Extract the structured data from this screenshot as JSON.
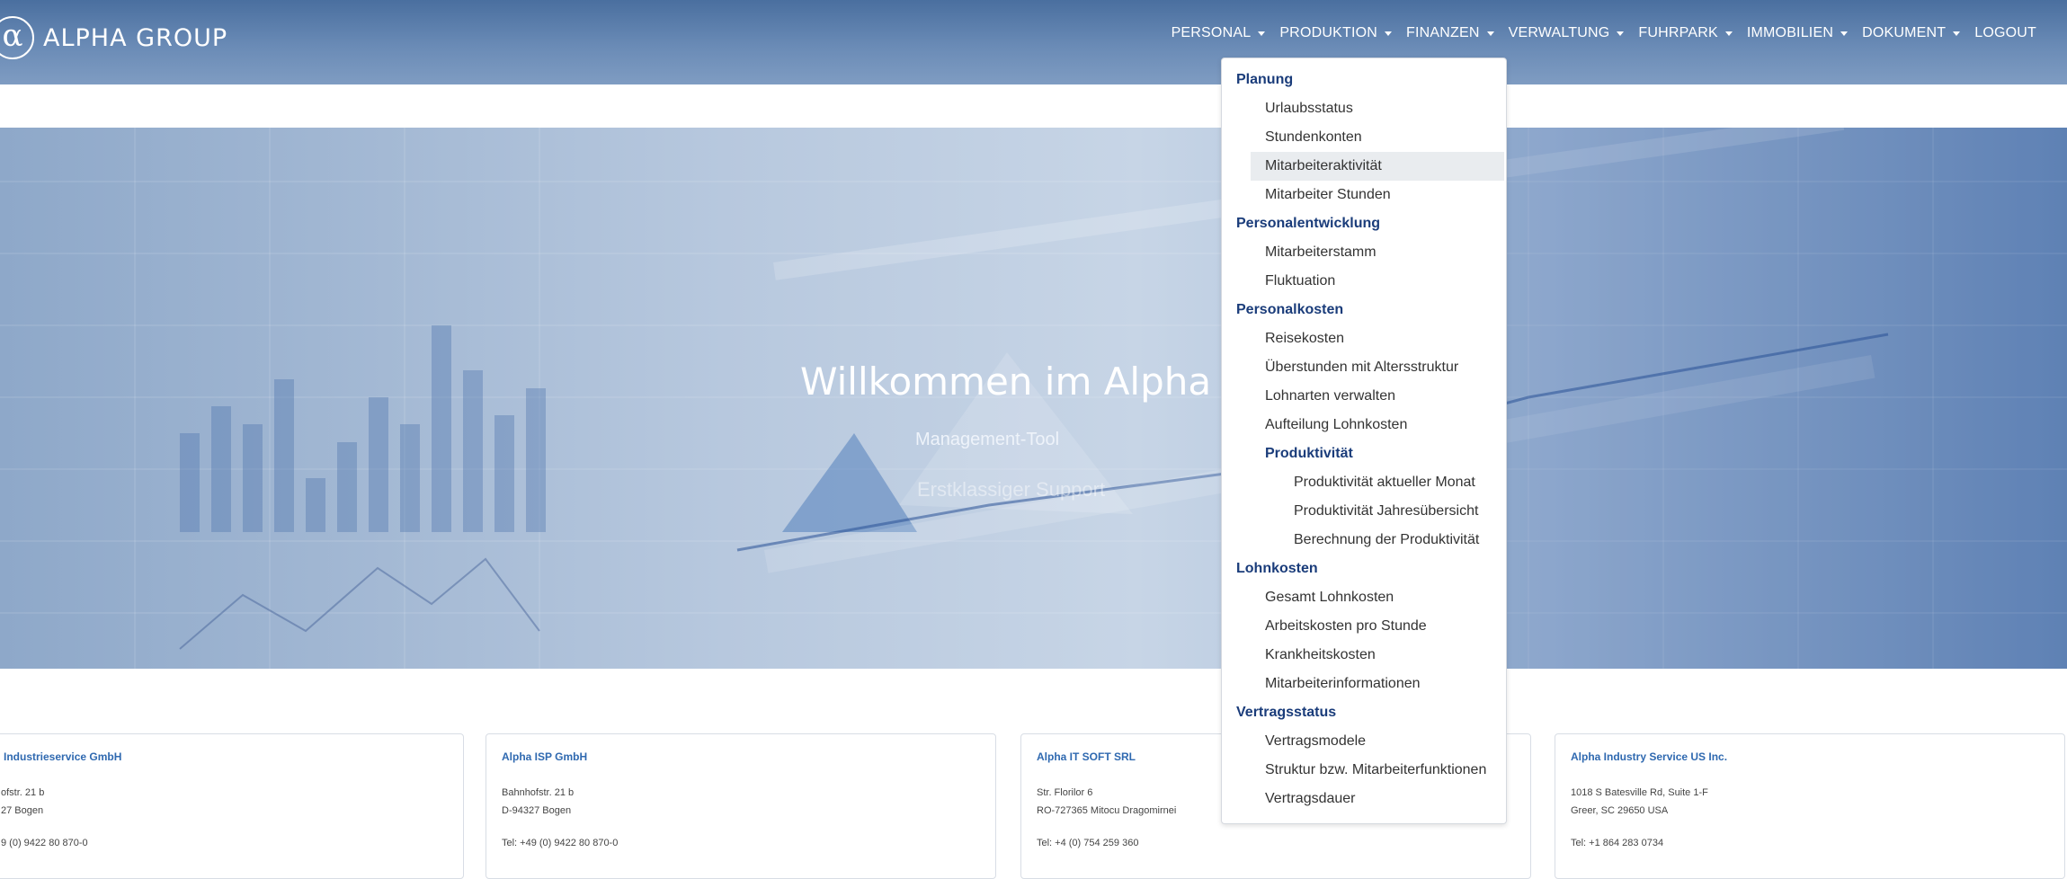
{
  "header": {
    "logo_glyph": "α",
    "logo_text": "ALPHA GROUP",
    "nav": [
      {
        "label": "PERSONAL",
        "has_caret": true
      },
      {
        "label": "PRODUKTION",
        "has_caret": true
      },
      {
        "label": "FINANZEN",
        "has_caret": true
      },
      {
        "label": "VERWALTUNG",
        "has_caret": true
      },
      {
        "label": "FUHRPARK",
        "has_caret": true
      },
      {
        "label": "IMMOBILIEN",
        "has_caret": true
      },
      {
        "label": "DOKUMENT",
        "has_caret": true
      },
      {
        "label": "LOGOUT",
        "has_caret": false
      }
    ]
  },
  "hero": {
    "title": "Willkommen im Alpha Gro",
    "subtitle": "Management-Tool",
    "subtitle2": "Erstklassiger Support"
  },
  "dropdown": {
    "sections": [
      {
        "heading": "Planung",
        "items": [
          "Urlaubsstatus",
          "Stundenkonten",
          "Mitarbeiteraktivität",
          "Mitarbeiter Stunden"
        ]
      },
      {
        "heading": "Personalentwicklung",
        "items": [
          "Mitarbeiterstamm",
          "Fluktuation"
        ]
      },
      {
        "heading": "Personalkosten",
        "items": [
          "Reisekosten",
          "Überstunden mit Altersstruktur",
          "Lohnarten verwalten",
          "Aufteilung Lohnkosten"
        ],
        "subheading": "Produktivität",
        "subitems": [
          "Produktivität aktueller Monat",
          "Produktivität Jahresübersicht",
          "Berechnung der Produktivität"
        ]
      },
      {
        "heading": "Lohnkosten",
        "items": [
          "Gesamt Lohnkosten",
          "Arbeitskosten pro Stunde",
          "Krankheitskosten",
          "Mitarbeiterinformationen"
        ]
      },
      {
        "heading": "Vertragsstatus",
        "items": [
          "Vertragsmodele",
          "Struktur bzw. Mitarbeiterfunktionen",
          "Vertragsdauer"
        ]
      }
    ],
    "active_item": "Mitarbeiteraktivität"
  },
  "cards": [
    {
      "name": "Industrieservice GmbH",
      "address1": "ofstr. 21 b",
      "address2": "27 Bogen",
      "phone": "9 (0) 9422 80 870-0"
    },
    {
      "name": "Alpha ISP GmbH",
      "address1": "Bahnhofstr. 21 b",
      "address2": "D-94327 Bogen",
      "phone": "Tel: +49 (0) 9422 80 870-0"
    },
    {
      "name": "Alpha IT SOFT SRL",
      "address1": "Str. Florilor 6",
      "address2": "RO-727365 Mitocu Dragomirnei",
      "phone": "Tel: +4 (0) 754 259 360"
    },
    {
      "name": "Alpha Industry Service US Inc.",
      "address1": "1018 S Batesville Rd, Suite 1-F",
      "address2": "Greer, SC 29650 USA",
      "phone": "Tel: +1 864 283 0734"
    }
  ],
  "colors": {
    "header": "#5a7eae",
    "accent": "#1a3c7a",
    "card_link": "#2f69b0"
  }
}
